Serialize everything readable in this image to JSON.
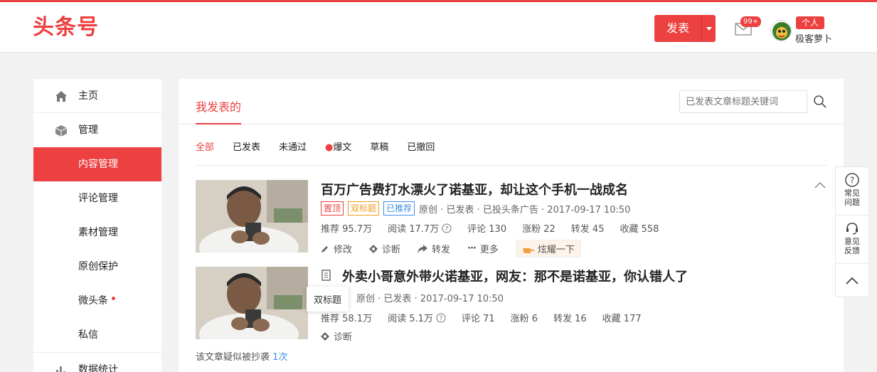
{
  "header": {
    "logo": "头条号",
    "publish_label": "发表",
    "mail_badge": "99+",
    "role_tag": "个人",
    "user_name": "极客萝卜"
  },
  "sidebar": {
    "items": [
      {
        "label": "主页",
        "icon": "home-icon"
      },
      {
        "label": "管理",
        "icon": "cube-icon"
      },
      {
        "label": "内容管理"
      },
      {
        "label": "评论管理"
      },
      {
        "label": "素材管理"
      },
      {
        "label": "原创保护"
      },
      {
        "label": "微头条"
      },
      {
        "label": "私信"
      },
      {
        "label": "数据统计",
        "icon": "bar-chart-icon"
      }
    ]
  },
  "main": {
    "tab_title": "我发表的",
    "search_placeholder": "已发表文章标题关键词",
    "filters": [
      "全部",
      "已发表",
      "未通过",
      "爆文",
      "草稿",
      "已撤回"
    ],
    "articles": [
      {
        "title": "百万广告费打水漂火了诺基亚，却让这个手机一战成名",
        "tags": [
          "置顶",
          "双标题",
          "已推荐"
        ],
        "meta": "原创 · 已发表 · 已投头条广告 · 2017-09-17 10:50",
        "stats": {
          "recommend": "推荐 95.7万",
          "read": "阅读 17.7万",
          "comment": "评论 130",
          "fans": "涨粉 22",
          "share": "转发 45",
          "fav": "收藏 558"
        },
        "actions": {
          "edit": "修改",
          "diagnose": "诊断",
          "forward": "转发",
          "more": "更多",
          "flaunt": "炫耀一下"
        }
      },
      {
        "title": "外卖小哥意外带火诺基亚，网友：那不是诺基亚，你认错人了",
        "meta": "原创 · 已发表 · 2017-09-17 10:50",
        "stats": {
          "recommend": "推荐 58.1万",
          "read": "阅读 5.1万",
          "comment": "评论 71",
          "fans": "涨粉 6",
          "share": "转发 16",
          "fav": "收藏 177"
        },
        "actions": {
          "diagnose": "诊断"
        }
      }
    ],
    "tooltip": "双标题",
    "plagiarism_text": "该文章疑似被抄袭",
    "plagiarism_count": "1次"
  },
  "float_bar": {
    "faq": "常见问题",
    "feedback": "意见反馈"
  },
  "colors": {
    "accent": "#ed4040",
    "blue": "#3a8ee6",
    "orange": "#f39a1c"
  }
}
